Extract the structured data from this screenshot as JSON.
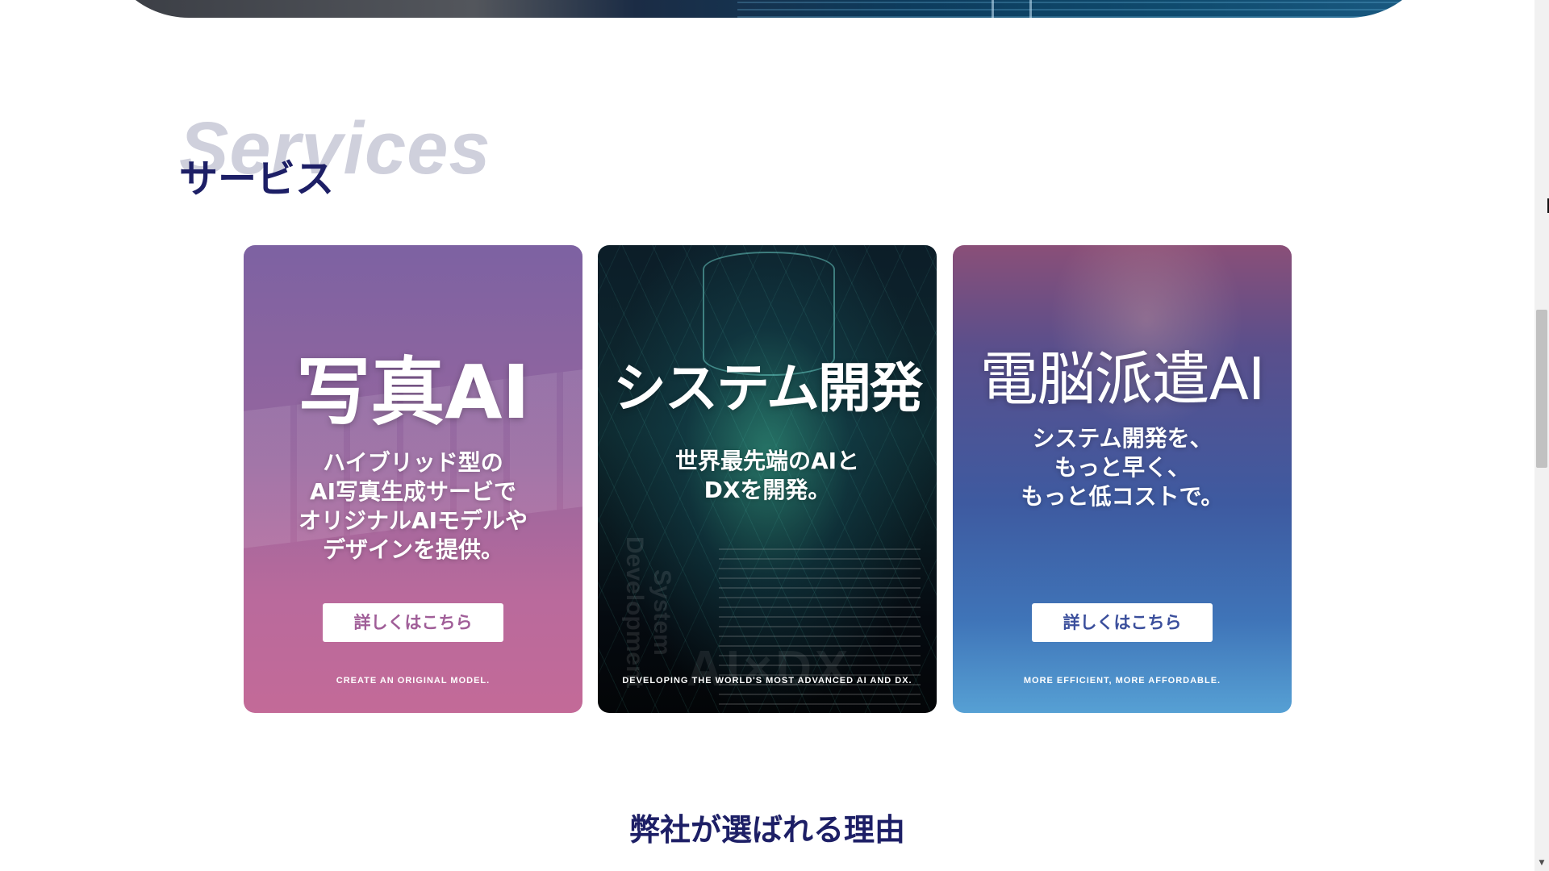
{
  "services": {
    "heading_en": "Services",
    "heading_ja": "サービス"
  },
  "cards": [
    {
      "title": "写真AI",
      "description": "ハイブリッド型の\nAI写真生成サービで\nオリジナルAIモデルや\nデザインを提供。",
      "button_label": "詳しくはこちら",
      "tagline": "CREATE AN ORIGINAL MODEL.",
      "accent": "#a05e98"
    },
    {
      "title": "システム開発",
      "description": "世界最先端のAIと\nDXを開発。",
      "tagline": "DEVELOPING THE WORLD'S MOST ADVANCED AI AND DX.",
      "watermark": "AI×DX",
      "vertical_text": "System Development"
    },
    {
      "title": "電脳派遣AI",
      "description": "システム開発を、\nもっと早く、\nもっと低コストで。",
      "button_label": "詳しくはこちら",
      "tagline": "MORE EFFICIENT, MORE AFFORDABLE.",
      "accent": "#3b4f9c"
    }
  ],
  "reasons": {
    "heading": "弊社が選ばれる理由"
  },
  "colors": {
    "navy": "#1d1f66",
    "heading_ghost": "#cfd0dc"
  },
  "icons": {
    "scroll_down": "scroll-down-arrow-icon"
  }
}
